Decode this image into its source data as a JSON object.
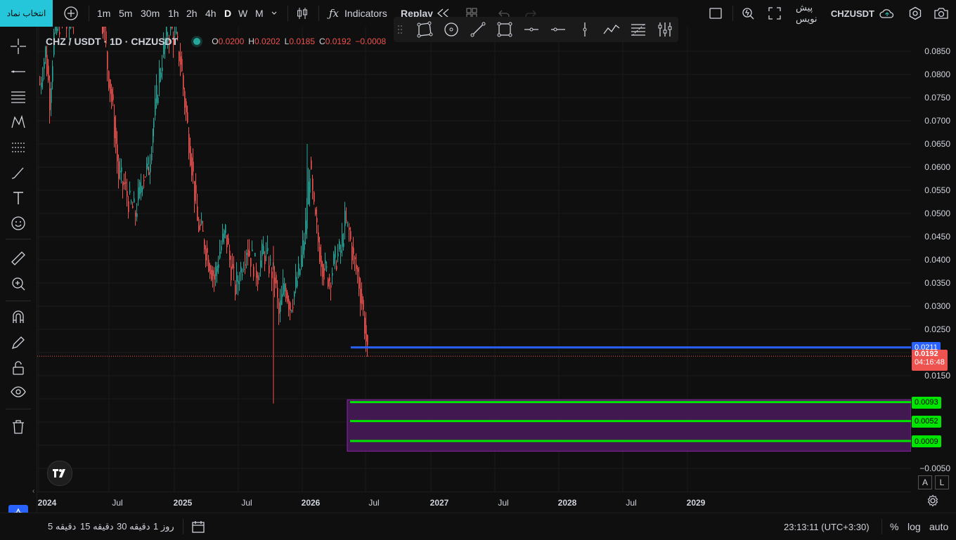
{
  "topbar": {
    "symbol_button": "انتخاب نماد",
    "intervals": [
      "1m",
      "5m",
      "30m",
      "1h",
      "2h",
      "4h",
      "D",
      "W",
      "M"
    ],
    "active_interval": "D",
    "indicators_label": "Indicators",
    "replay_label": "Replay",
    "chart_name": "CHZUSDT",
    "chart_layout_label": "پیش نویس"
  },
  "legend": {
    "title": "CHZ / USDT · 1D · CHZUSDT",
    "open_label": "O",
    "open": "0.0200",
    "high_label": "H",
    "high": "0.0202",
    "low_label": "L",
    "low": "0.0185",
    "close_label": "C",
    "close": "0.0192",
    "change": "−0.0008"
  },
  "price_axis": {
    "ticks": [
      "0.0850",
      "0.0800",
      "0.0750",
      "0.0700",
      "0.0650",
      "0.0600",
      "0.0550",
      "0.0500",
      "0.0450",
      "0.0400",
      "0.0350",
      "0.0300",
      "0.0250",
      "0.0150",
      "−0.0050"
    ],
    "tags": {
      "blue_line": "0.0211",
      "last_price": "0.0192",
      "countdown": "04:16:48",
      "green1": "0.0093",
      "green2": "0.0052",
      "green3": "0.0009"
    },
    "btn_a": "A",
    "btn_l": "L"
  },
  "time_axis": {
    "labels": [
      "2024",
      "Jul",
      "2025",
      "Jul",
      "2026",
      "Jul",
      "2027",
      "Jul",
      "2028",
      "Jul",
      "2029"
    ]
  },
  "bottombar": {
    "ranges": [
      "5 دقیقه",
      "15 دقیقه",
      "30 دقیقه",
      "1 روز"
    ],
    "clock": "23:13:11 (UTC+3:30)",
    "percent": "%",
    "log": "log",
    "auto": "auto"
  },
  "colors": {
    "accent": "#26c6da",
    "up": "#26a69a",
    "down": "#ef5350",
    "blue_line": "#2962ff",
    "green_line": "#00e600",
    "zone": "#4a1a5c"
  }
}
